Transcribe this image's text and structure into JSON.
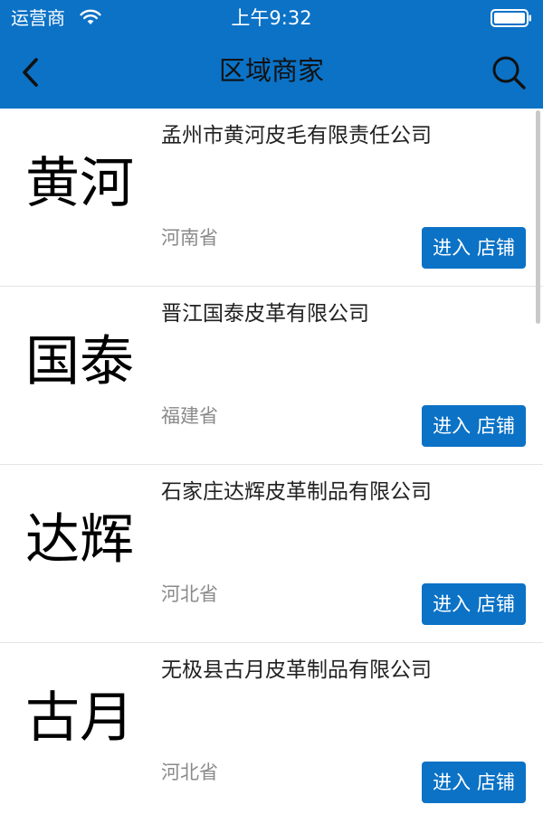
{
  "status_bar": {
    "carrier": "运营商",
    "time": "上午9:32",
    "wifi_icon": "wifi-icon",
    "battery_icon": "battery-icon"
  },
  "nav": {
    "title": "区域商家",
    "back_icon": "chevron-left-icon",
    "search_icon": "search-icon"
  },
  "colors": {
    "brand_blue": "#0b72c6",
    "province_gray": "#8a8a8a",
    "divider": "#e4e4e4"
  },
  "merchants": [
    {
      "logo_text": "黄河",
      "name": "孟州市黄河皮毛有限责任公司",
      "province": "河南省",
      "button": "进入 店铺"
    },
    {
      "logo_text": "国泰",
      "name": "晋江国泰皮革有限公司",
      "province": "福建省",
      "button": "进入 店铺"
    },
    {
      "logo_text": "达辉",
      "name": "石家庄达辉皮革制品有限公司",
      "province": "河北省",
      "button": "进入 店铺"
    },
    {
      "logo_text": "古月",
      "name": "无极县古月皮革制品有限公司",
      "province": "河北省",
      "button": "进入 店铺"
    }
  ]
}
